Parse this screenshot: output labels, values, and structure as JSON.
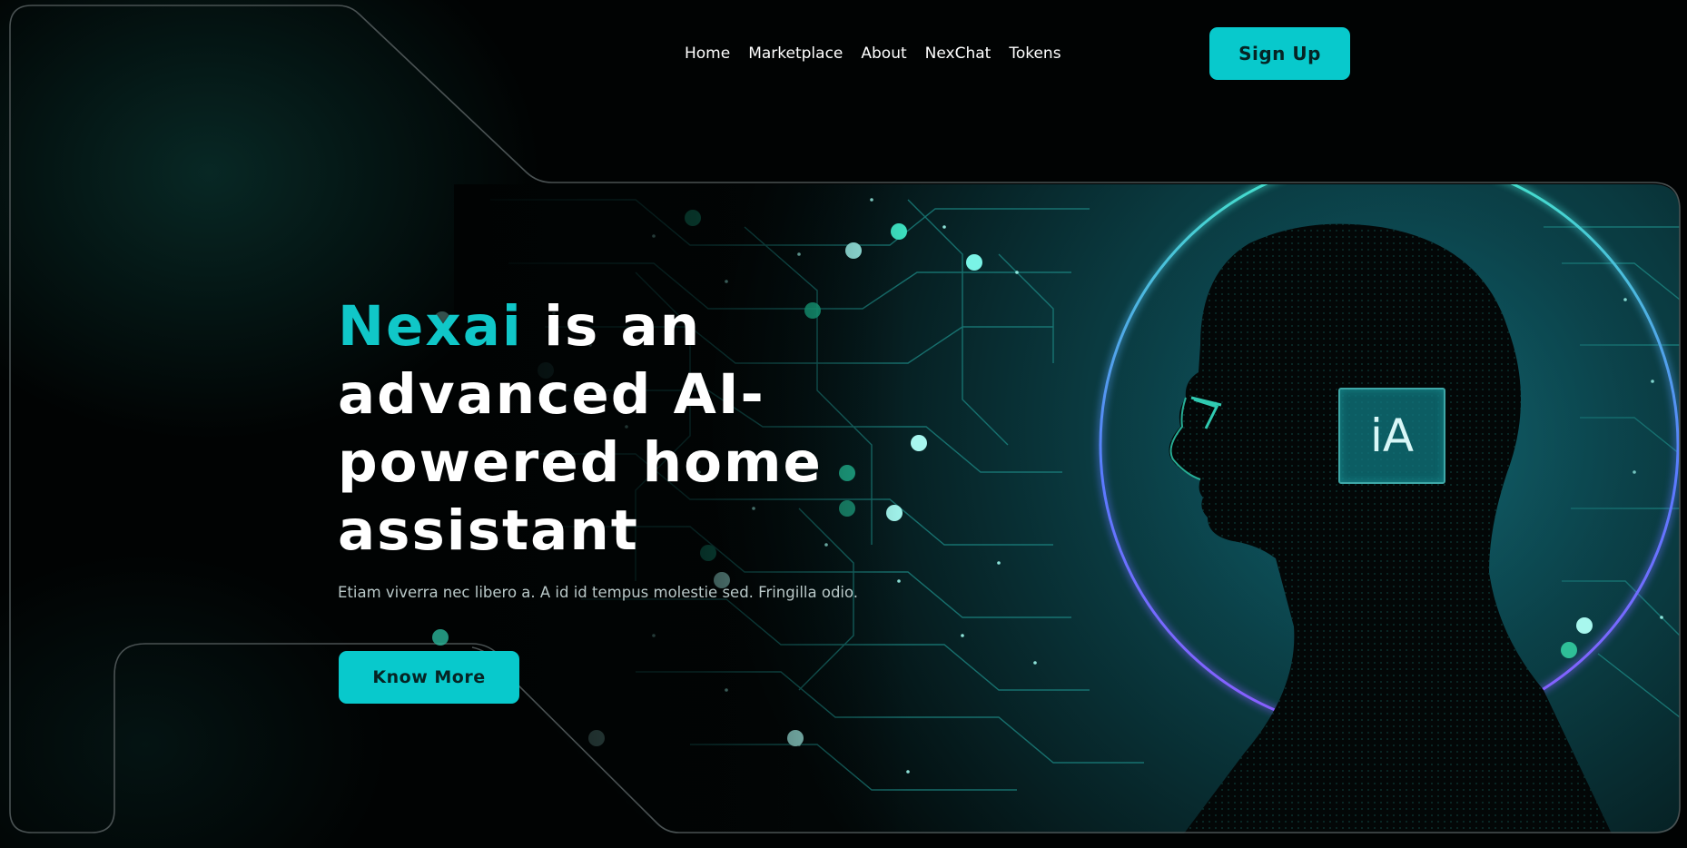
{
  "nav": {
    "items": [
      {
        "label": "Home"
      },
      {
        "label": "Marketplace"
      },
      {
        "label": "About"
      },
      {
        "label": "NexChat"
      },
      {
        "label": "Tokens"
      }
    ],
    "signup_label": "Sign Up"
  },
  "hero": {
    "brand": "Nexai",
    "headline_rest": " is an advanced AI-powered home assistant",
    "subtitle": "Etiam viverra nec libero a. A id id tempus molestie sed. Fringilla odio.",
    "cta_label": "Know More",
    "badge_text": "iA"
  },
  "colors": {
    "accent": "#08c9cc",
    "background": "#010303",
    "ring_purple": "#6b5cff",
    "ring_teal": "#46e0c4"
  },
  "icons": {
    "hero_image": "ai-head-profile-illustration",
    "ia_badge": "ia-chip-icon"
  }
}
